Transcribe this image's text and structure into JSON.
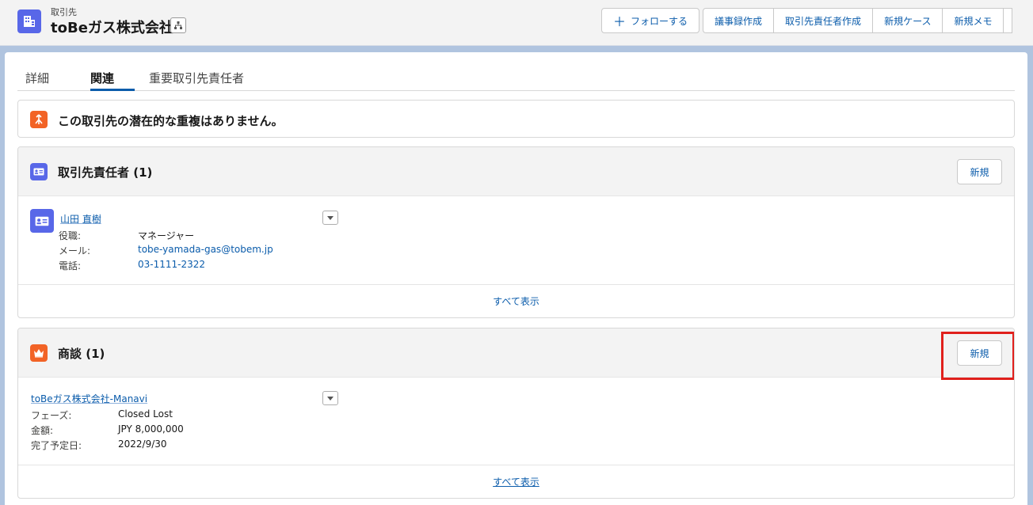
{
  "header": {
    "object_label": "取引先",
    "title": "toBeガス株式会社",
    "icon": "account-building-icon",
    "buttons": {
      "follow": "フォローする",
      "minutes": "議事録作成",
      "create_contact": "取引先責任者作成",
      "new_case": "新規ケース",
      "new_note": "新規メモ"
    }
  },
  "tabs": [
    "詳細",
    "関連",
    "重要取引先責任者"
  ],
  "active_tab": "関連",
  "duplicates": {
    "message": "この取引先の潜在的な重複はありません。"
  },
  "contacts": {
    "title": "取引先責任者 (1)",
    "new_label": "新規",
    "record": {
      "name": "山田 直樹",
      "fields": [
        {
          "label": "役職:",
          "value": "マネージャー"
        },
        {
          "label": "メール:",
          "value": "tobe-yamada-gas@tobem.jp"
        },
        {
          "label": "電話:",
          "value": "03-1111-2322"
        }
      ]
    },
    "view_all": "すべて表示"
  },
  "opportunities": {
    "title": "商談 (1)",
    "new_label": "新規",
    "record": {
      "name": "toBeガス株式会社-Manavi",
      "fields": [
        {
          "label": "フェーズ:",
          "value": "Closed Lost"
        },
        {
          "label": "金額:",
          "value": "JPY 8,000,000"
        },
        {
          "label": "完了予定日:",
          "value": "2022/9/30"
        }
      ]
    },
    "view_all": "すべて表示"
  },
  "colors": {
    "brand": "#0b5cab",
    "contact_icon": "#5867e8",
    "opportunity_icon": "#f26326",
    "highlight": "#e0201c"
  }
}
